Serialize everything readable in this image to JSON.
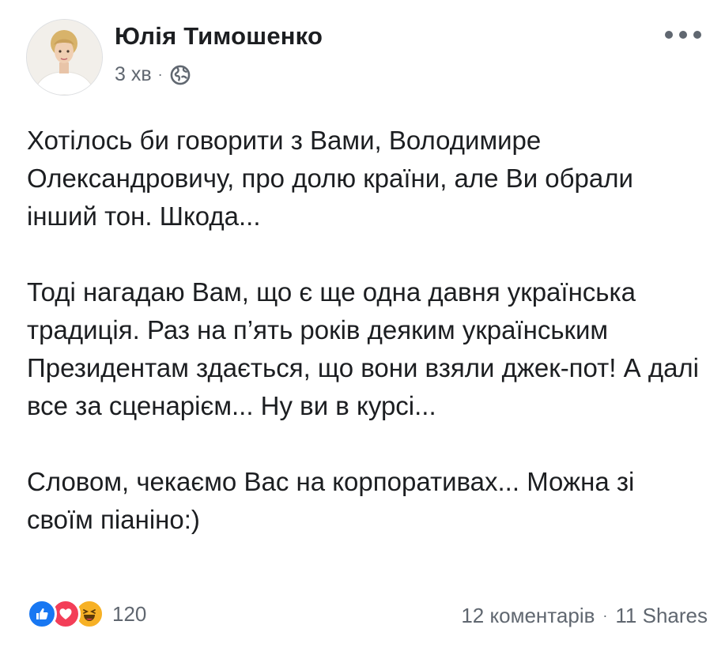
{
  "post": {
    "author": "Юлія Тимошенко",
    "time": "3 хв",
    "meta_separator": "·",
    "privacy_icon": "globe-icon",
    "more_icon": "more-horizontal-icon",
    "paragraphs": [
      "Хотілось би говорити з Вами, Володимире Олександровичу, про долю країни, але Ви обрали інший тон. Шкода...",
      "Тоді нагадаю Вам, що є ще одна давня українська традиція. Раз на п’ять років деяким українським Президентам здається, що вони взяли джек-пот! А далі все за сценарієм... Ну ви в курсі...",
      "Словом, чекаємо Вас на корпоративах... Можна зі своїм піаніно:)"
    ]
  },
  "footer": {
    "reactions": [
      "like-icon",
      "love-icon",
      "haha-icon"
    ],
    "reaction_count": "120",
    "comments": "12 коментарів",
    "separator": "·",
    "shares": "11 Shares"
  },
  "colors": {
    "text": "#1c1e21",
    "secondary": "#606770",
    "like": "#1877f2",
    "love": "#f33e58",
    "haha": "#f7b125"
  }
}
